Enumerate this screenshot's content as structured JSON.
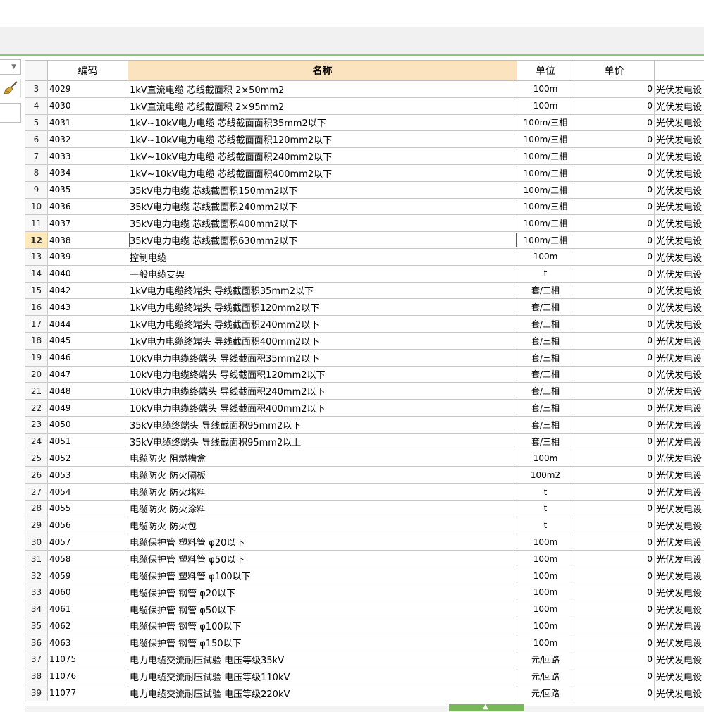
{
  "columns": {
    "code": "编码",
    "name": "名称",
    "unit": "单位",
    "price": "单价"
  },
  "rows": [
    {
      "no": "3",
      "code": "4029",
      "name": "1kV直流电缆 芯线截面积 2×50mm2",
      "unit": "100m",
      "price": "0",
      "category": "光伏发电设"
    },
    {
      "no": "4",
      "code": "4030",
      "name": "1kV直流电缆 芯线截面积 2×95mm2",
      "unit": "100m",
      "price": "0",
      "category": "光伏发电设"
    },
    {
      "no": "5",
      "code": "4031",
      "name": "1kV~10kV电力电缆 芯线截面面积35mm2以下",
      "unit": "100m/三相",
      "price": "0",
      "category": "光伏发电设"
    },
    {
      "no": "6",
      "code": "4032",
      "name": "1kV~10kV电力电缆 芯线截面面积120mm2以下",
      "unit": "100m/三相",
      "price": "0",
      "category": "光伏发电设"
    },
    {
      "no": "7",
      "code": "4033",
      "name": "1kV~10kV电力电缆 芯线截面面积240mm2以下",
      "unit": "100m/三相",
      "price": "0",
      "category": "光伏发电设"
    },
    {
      "no": "8",
      "code": "4034",
      "name": "1kV~10kV电力电缆 芯线截面面积400mm2以下",
      "unit": "100m/三相",
      "price": "0",
      "category": "光伏发电设"
    },
    {
      "no": "9",
      "code": "4035",
      "name": "35kV电力电缆 芯线截面积150mm2以下",
      "unit": "100m/三相",
      "price": "0",
      "category": "光伏发电设"
    },
    {
      "no": "10",
      "code": "4036",
      "name": "35kV电力电缆 芯线截面积240mm2以下",
      "unit": "100m/三相",
      "price": "0",
      "category": "光伏发电设"
    },
    {
      "no": "11",
      "code": "4037",
      "name": "35kV电力电缆 芯线截面积400mm2以下",
      "unit": "100m/三相",
      "price": "0",
      "category": "光伏发电设"
    },
    {
      "no": "12",
      "code": "4038",
      "name": "35kV电力电缆 芯线截面积630mm2以下",
      "unit": "100m/三相",
      "price": "0",
      "category": "光伏发电设"
    },
    {
      "no": "13",
      "code": "4039",
      "name": "控制电缆",
      "unit": "100m",
      "price": "0",
      "category": "光伏发电设"
    },
    {
      "no": "14",
      "code": "4040",
      "name": "一般电缆支架",
      "unit": "t",
      "price": "0",
      "category": "光伏发电设"
    },
    {
      "no": "15",
      "code": "4042",
      "name": "1kV电力电缆终端头 导线截面积35mm2以下",
      "unit": "套/三相",
      "price": "0",
      "category": "光伏发电设"
    },
    {
      "no": "16",
      "code": "4043",
      "name": "1kV电力电缆终端头 导线截面积120mm2以下",
      "unit": "套/三相",
      "price": "0",
      "category": "光伏发电设"
    },
    {
      "no": "17",
      "code": "4044",
      "name": "1kV电力电缆终端头 导线截面积240mm2以下",
      "unit": "套/三相",
      "price": "0",
      "category": "光伏发电设"
    },
    {
      "no": "18",
      "code": "4045",
      "name": "1kV电力电缆终端头 导线截面积400mm2以下",
      "unit": "套/三相",
      "price": "0",
      "category": "光伏发电设"
    },
    {
      "no": "19",
      "code": "4046",
      "name": "10kV电力电缆终端头 导线截面积35mm2以下",
      "unit": "套/三相",
      "price": "0",
      "category": "光伏发电设"
    },
    {
      "no": "20",
      "code": "4047",
      "name": "10kV电力电缆终端头 导线截面积120mm2以下",
      "unit": "套/三相",
      "price": "0",
      "category": "光伏发电设"
    },
    {
      "no": "21",
      "code": "4048",
      "name": "10kV电力电缆终端头 导线截面积240mm2以下",
      "unit": "套/三相",
      "price": "0",
      "category": "光伏发电设"
    },
    {
      "no": "22",
      "code": "4049",
      "name": "10kV电力电缆终端头 导线截面积400mm2以下",
      "unit": "套/三相",
      "price": "0",
      "category": "光伏发电设"
    },
    {
      "no": "23",
      "code": "4050",
      "name": "35kV电缆终端头 导线截面积95mm2以下",
      "unit": "套/三相",
      "price": "0",
      "category": "光伏发电设"
    },
    {
      "no": "24",
      "code": "4051",
      "name": "35kV电缆终端头 导线截面积95mm2以上",
      "unit": "套/三相",
      "price": "0",
      "category": "光伏发电设"
    },
    {
      "no": "25",
      "code": "4052",
      "name": "电缆防火 阻燃槽盒",
      "unit": "100m",
      "price": "0",
      "category": "光伏发电设"
    },
    {
      "no": "26",
      "code": "4053",
      "name": "电缆防火 防火隔板",
      "unit": "100m2",
      "price": "0",
      "category": "光伏发电设"
    },
    {
      "no": "27",
      "code": "4054",
      "name": "电缆防火 防火堵料",
      "unit": "t",
      "price": "0",
      "category": "光伏发电设"
    },
    {
      "no": "28",
      "code": "4055",
      "name": "电缆防火 防火涂料",
      "unit": "t",
      "price": "0",
      "category": "光伏发电设"
    },
    {
      "no": "29",
      "code": "4056",
      "name": "电缆防火 防火包",
      "unit": "t",
      "price": "0",
      "category": "光伏发电设"
    },
    {
      "no": "30",
      "code": "4057",
      "name": "电缆保护管 塑料管 φ20以下",
      "unit": "100m",
      "price": "0",
      "category": "光伏发电设"
    },
    {
      "no": "31",
      "code": "4058",
      "name": "电缆保护管 塑料管 φ50以下",
      "unit": "100m",
      "price": "0",
      "category": "光伏发电设"
    },
    {
      "no": "32",
      "code": "4059",
      "name": "电缆保护管 塑料管 φ100以下",
      "unit": "100m",
      "price": "0",
      "category": "光伏发电设"
    },
    {
      "no": "33",
      "code": "4060",
      "name": "电缆保护管 钢管 φ20以下",
      "unit": "100m",
      "price": "0",
      "category": "光伏发电设"
    },
    {
      "no": "34",
      "code": "4061",
      "name": "电缆保护管 钢管 φ50以下",
      "unit": "100m",
      "price": "0",
      "category": "光伏发电设"
    },
    {
      "no": "35",
      "code": "4062",
      "name": "电缆保护管 钢管 φ100以下",
      "unit": "100m",
      "price": "0",
      "category": "光伏发电设"
    },
    {
      "no": "36",
      "code": "4063",
      "name": "电缆保护管 钢管 φ150以下",
      "unit": "100m",
      "price": "0",
      "category": "光伏发电设"
    },
    {
      "no": "37",
      "code": "11075",
      "name": "电力电缆交流耐压试验 电压等级35kV",
      "unit": "元/回路",
      "price": "0",
      "category": "光伏发电设"
    },
    {
      "no": "38",
      "code": "11076",
      "name": "电力电缆交流耐压试验 电压等级110kV",
      "unit": "元/回路",
      "price": "0",
      "category": "光伏发电设"
    },
    {
      "no": "39",
      "code": "11077",
      "name": "电力电缆交流耐压试验 电压等级220kV",
      "unit": "元/回路",
      "price": "0",
      "category": "光伏发电设"
    }
  ],
  "selected_row_no": "12",
  "colors": {
    "header_sorted": "#fbe3bf",
    "selected_row_header": "#ffe9b8",
    "accent_green": "#79b85a"
  },
  "icons": {
    "clear": "broom-icon",
    "dropdown": "chevron-down-icon",
    "collapse": "chevron-up-icon"
  }
}
